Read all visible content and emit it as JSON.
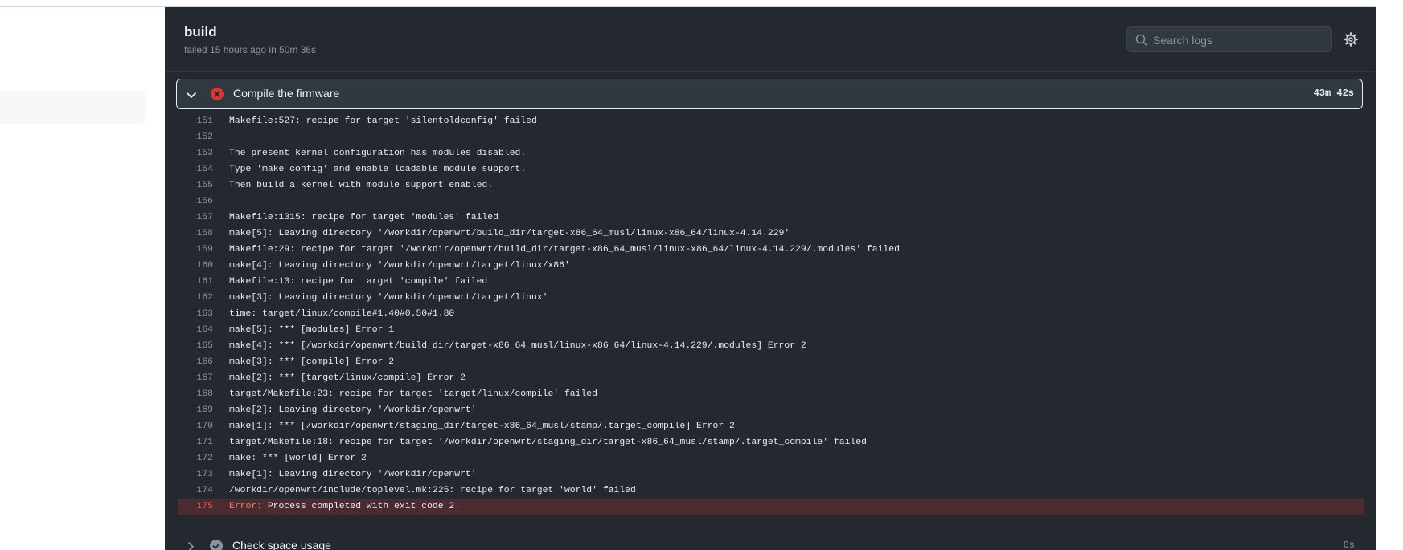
{
  "job": {
    "title": "build",
    "subtitle": "failed 15 hours ago in 50m 36s"
  },
  "search": {
    "placeholder": "Search logs",
    "icon": "search-icon"
  },
  "settings": {
    "icon": "gear-icon"
  },
  "step": {
    "name": "Compile the firmware",
    "duration": "43m 42s",
    "status": "failed",
    "expanded": true
  },
  "log": {
    "lines": [
      {
        "num": "151",
        "text": "Makefile:527: recipe for target 'silentoldconfig' failed"
      },
      {
        "num": "152",
        "text": ""
      },
      {
        "num": "153",
        "text": "The present kernel configuration has modules disabled."
      },
      {
        "num": "154",
        "text": "Type 'make config' and enable loadable module support."
      },
      {
        "num": "155",
        "text": "Then build a kernel with module support enabled."
      },
      {
        "num": "156",
        "text": ""
      },
      {
        "num": "157",
        "text": "Makefile:1315: recipe for target 'modules' failed"
      },
      {
        "num": "158",
        "text": "make[5]: Leaving directory '/workdir/openwrt/build_dir/target-x86_64_musl/linux-x86_64/linux-4.14.229'"
      },
      {
        "num": "159",
        "text": "Makefile:29: recipe for target '/workdir/openwrt/build_dir/target-x86_64_musl/linux-x86_64/linux-4.14.229/.modules' failed"
      },
      {
        "num": "160",
        "text": "make[4]: Leaving directory '/workdir/openwrt/target/linux/x86'"
      },
      {
        "num": "161",
        "text": "Makefile:13: recipe for target 'compile' failed"
      },
      {
        "num": "162",
        "text": "make[3]: Leaving directory '/workdir/openwrt/target/linux'"
      },
      {
        "num": "163",
        "text": "time: target/linux/compile#1.40#0.50#1.80"
      },
      {
        "num": "164",
        "text": "make[5]: *** [modules] Error 1"
      },
      {
        "num": "165",
        "text": "make[4]: *** [/workdir/openwrt/build_dir/target-x86_64_musl/linux-x86_64/linux-4.14.229/.modules] Error 2"
      },
      {
        "num": "166",
        "text": "make[3]: *** [compile] Error 2"
      },
      {
        "num": "167",
        "text": "make[2]: *** [target/linux/compile] Error 2"
      },
      {
        "num": "168",
        "text": "target/Makefile:23: recipe for target 'target/linux/compile' failed"
      },
      {
        "num": "169",
        "text": "make[2]: Leaving directory '/workdir/openwrt'"
      },
      {
        "num": "170",
        "text": "make[1]: *** [/workdir/openwrt/staging_dir/target-x86_64_musl/stamp/.target_compile] Error 2"
      },
      {
        "num": "171",
        "text": "target/Makefile:18: recipe for target '/workdir/openwrt/staging_dir/target-x86_64_musl/stamp/.target_compile' failed"
      },
      {
        "num": "172",
        "text": "make: *** [world] Error 2"
      },
      {
        "num": "173",
        "text": "make[1]: Leaving directory '/workdir/openwrt'"
      },
      {
        "num": "174",
        "text": "/workdir/openwrt/include/toplevel.mk:225: recipe for target 'world' failed"
      }
    ],
    "error_line": {
      "num": "175",
      "label": "Error:",
      "text": " Process completed with exit code 2."
    }
  },
  "next_step": {
    "name": "Check space usage",
    "duration": "0s",
    "status": "success"
  },
  "colors": {
    "panel_bg": "#24292f",
    "step_header_bg": "#32383f",
    "error_row_bg": "#4b2a30",
    "fail_red": "#da3633",
    "success_gray": "#8b949e"
  }
}
